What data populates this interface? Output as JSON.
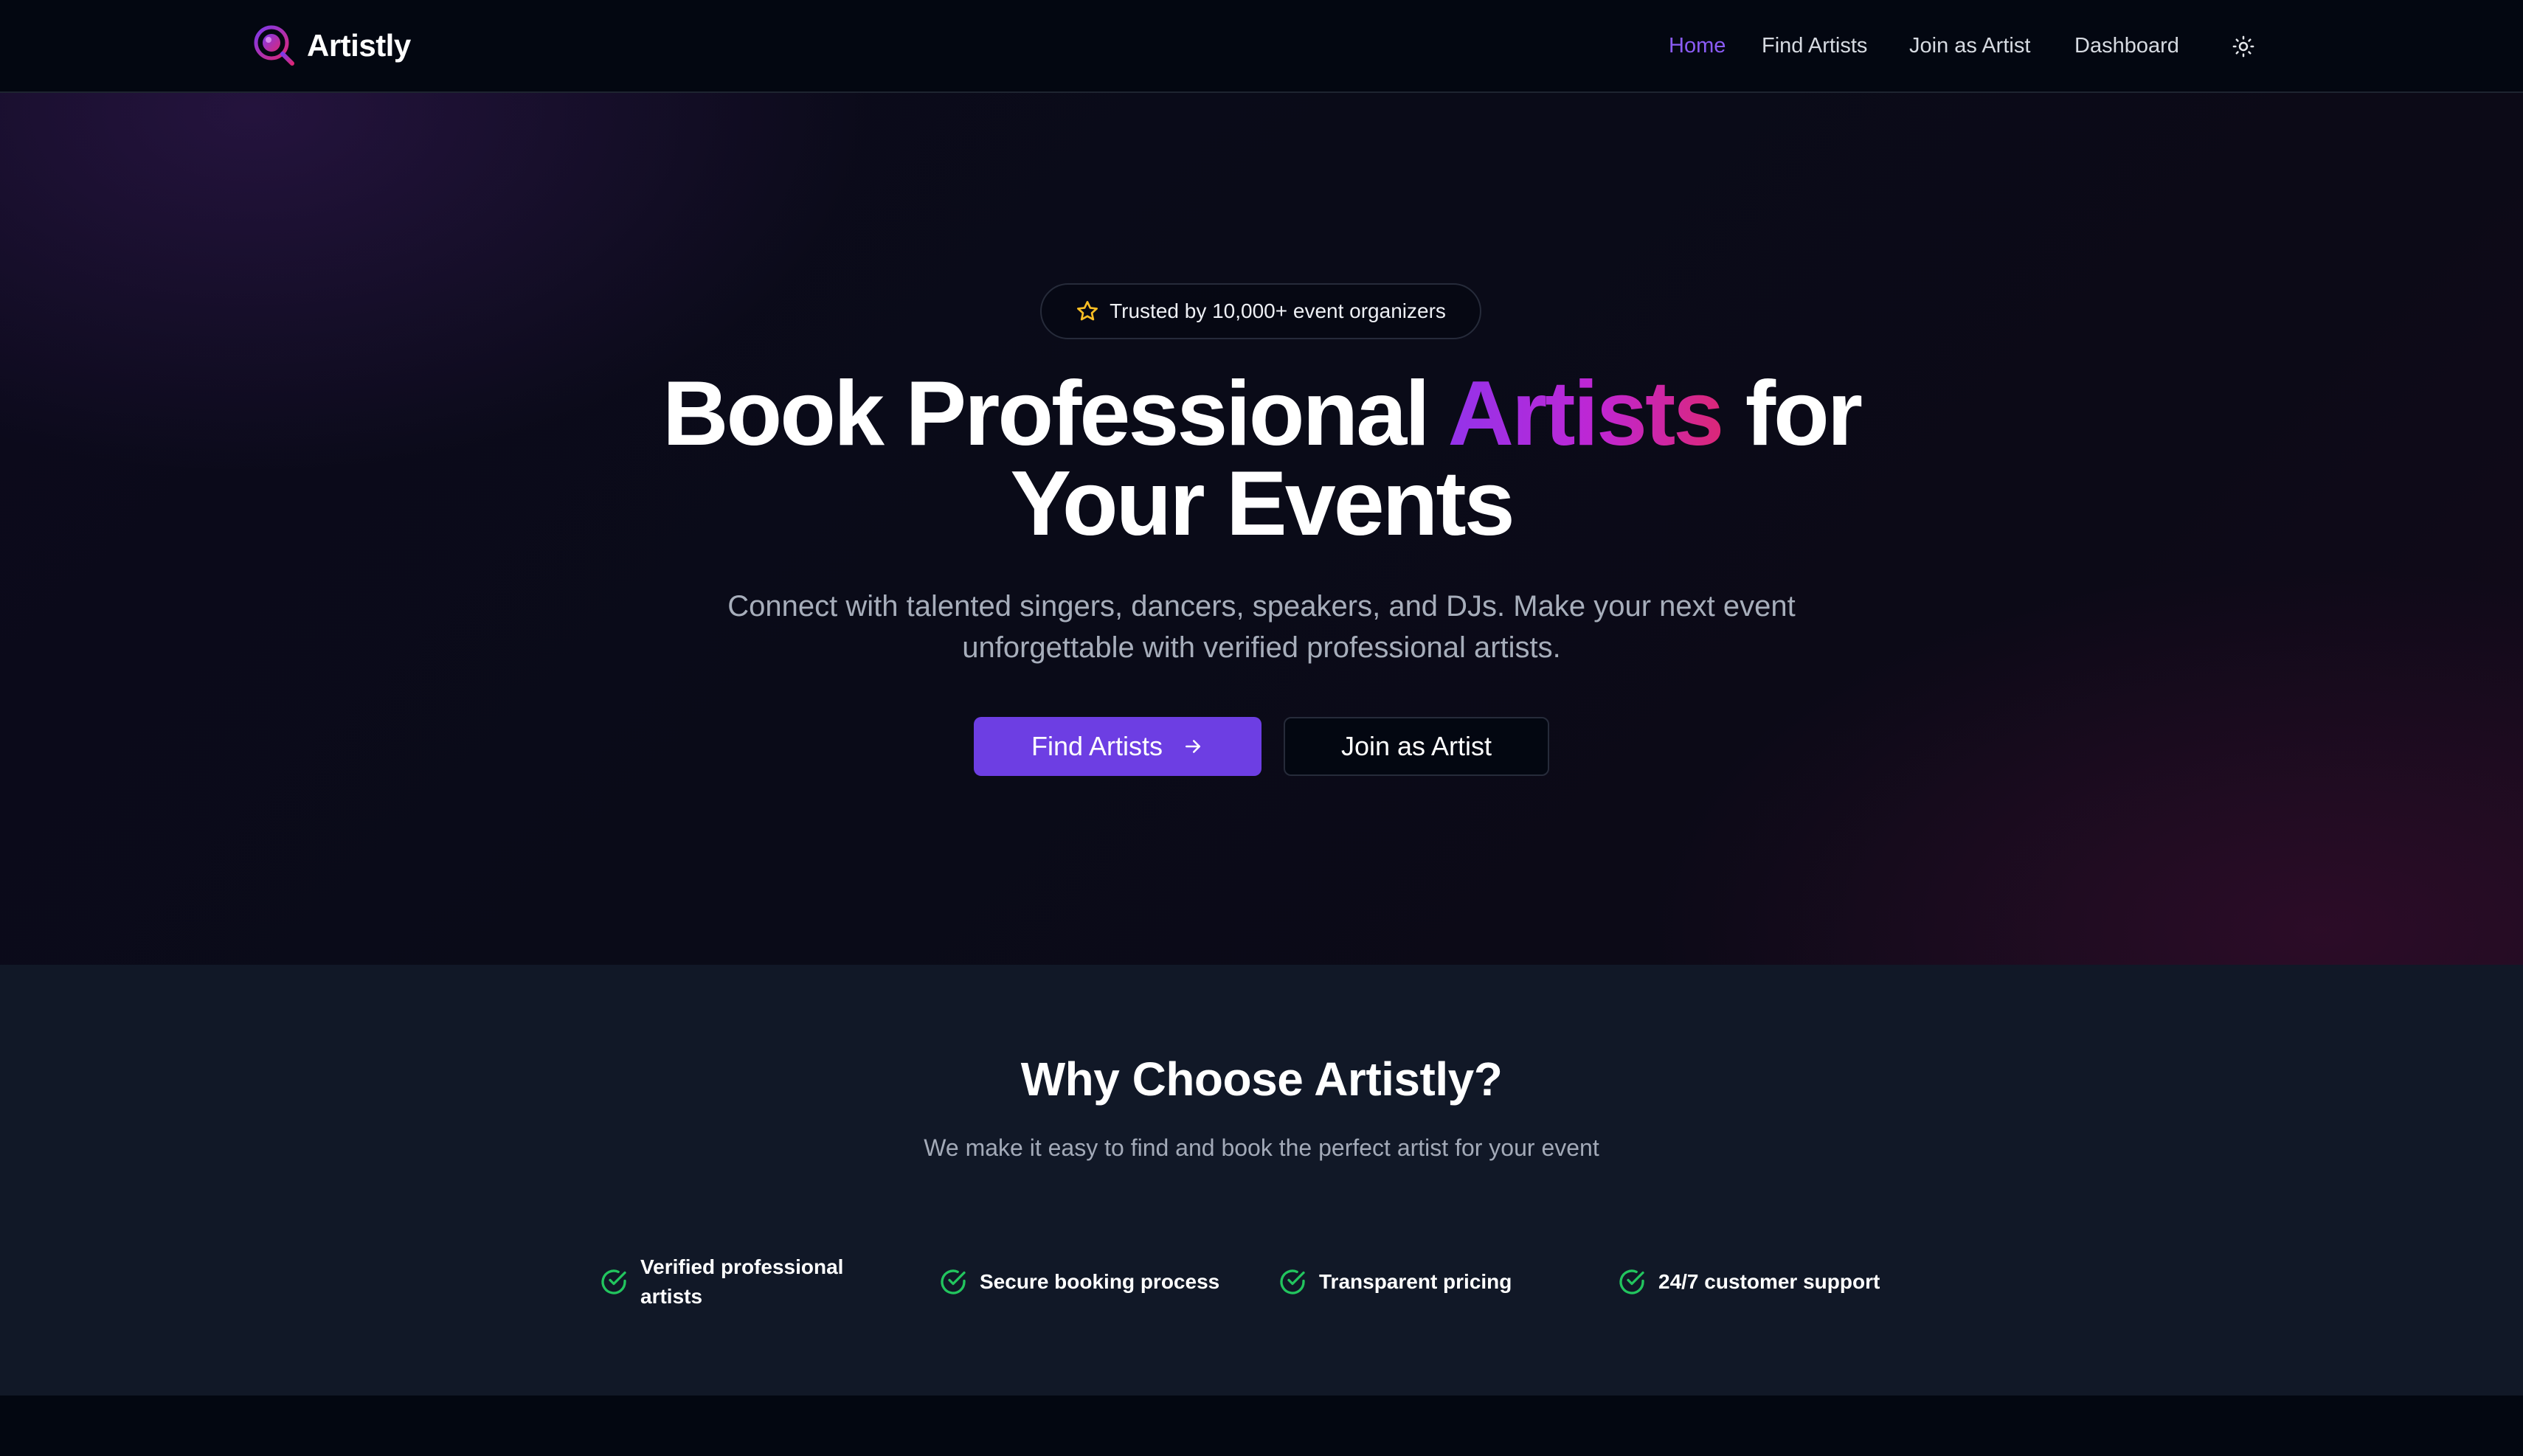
{
  "header": {
    "brand": "Artistly",
    "nav": {
      "home": "Home",
      "find_artists": "Find Artists",
      "join_as_artist": "Join as Artist",
      "dashboard": "Dashboard"
    },
    "theme_icon": "sun-icon"
  },
  "hero": {
    "badge": {
      "icon": "star-icon",
      "text": "Trusted by 10,000+ event organizers"
    },
    "title": {
      "part1": "Book Professional ",
      "accent": "Artists",
      "part2": " for",
      "line2": "Your Events"
    },
    "subtitle": "Connect with talented singers, dancers, speakers, and DJs. Make your next event unforgettable with verified professional artists.",
    "primary_button": "Find Artists",
    "secondary_button": "Join as Artist"
  },
  "why": {
    "title": "Why Choose Artistly?",
    "subtitle": "We make it easy to find and book the perfect artist for your event",
    "features": [
      {
        "icon": "check-circle-icon",
        "label": "Verified professional artists"
      },
      {
        "icon": "check-circle-icon",
        "label": "Secure booking process"
      },
      {
        "icon": "check-circle-icon",
        "label": "Transparent pricing"
      },
      {
        "icon": "check-circle-icon",
        "label": "24/7 customer support"
      }
    ]
  },
  "colors": {
    "accent": "#7c3aed",
    "accent_gradient": [
      "#9333ea",
      "#db2777"
    ],
    "check_green": "#22c55e",
    "background": "#030711",
    "section_bg": "#111827"
  }
}
